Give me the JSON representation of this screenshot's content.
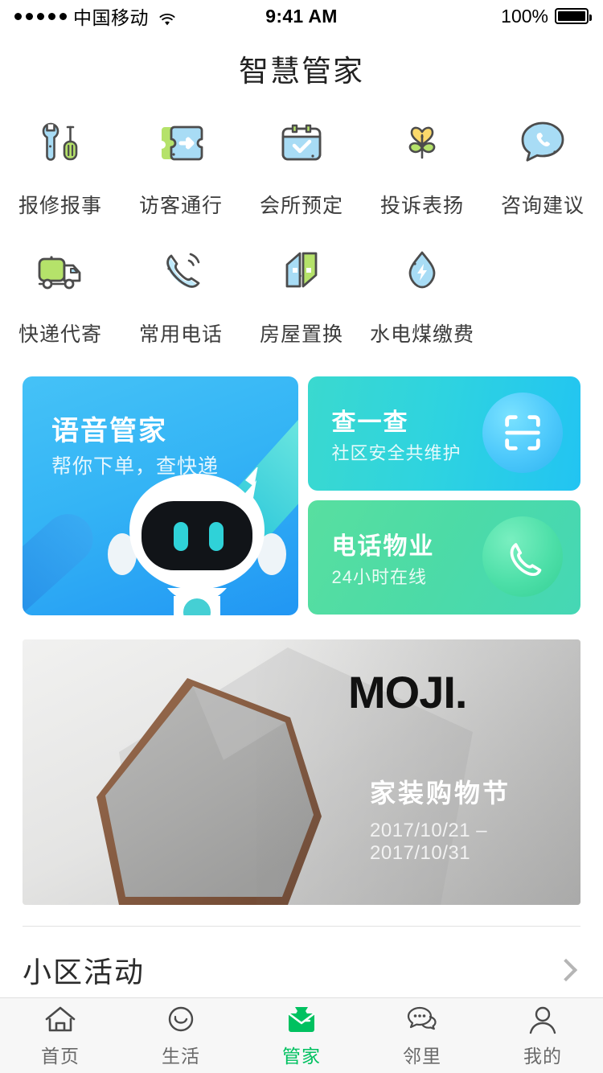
{
  "status_bar": {
    "carrier": "中国移动",
    "signal_icon": "signal-dots-icon",
    "wifi_icon": "wifi-icon",
    "time": "9:41 AM",
    "battery_percent": "100%",
    "battery_icon": "battery-full-icon"
  },
  "header": {
    "title": "智慧管家"
  },
  "services": {
    "row1": [
      {
        "label": "报修报事",
        "icon": "wrench-screwdriver-icon"
      },
      {
        "label": "访客通行",
        "icon": "visitor-pass-ticket-icon"
      },
      {
        "label": "会所预定",
        "icon": "calendar-check-icon"
      },
      {
        "label": "投诉表扬",
        "icon": "heart-flower-icon"
      },
      {
        "label": "咨询建议",
        "icon": "speech-bubble-phone-icon"
      }
    ],
    "row2": [
      {
        "label": "快递代寄",
        "icon": "delivery-truck-icon"
      },
      {
        "label": "常用电话",
        "icon": "ringing-phone-icon"
      },
      {
        "label": "房屋置换",
        "icon": "house-swap-icon"
      },
      {
        "label": "水电煤缴费",
        "icon": "water-drop-bolt-icon"
      }
    ]
  },
  "promos": {
    "voice": {
      "title": "语音管家",
      "subtitle": "帮你下单，查快递",
      "art": "robot-mascot-illustration",
      "bg_from": "#45c2f7",
      "bg_to": "#2196f3"
    },
    "scan": {
      "title": "查一查",
      "subtitle": "社区安全共维护",
      "icon": "scan-frame-icon",
      "bg_from": "#3ad9cf",
      "bg_to": "#22c4f2"
    },
    "call": {
      "title": "电话物业",
      "subtitle": "24小时在线",
      "icon": "phone-handset-icon",
      "bg_from": "#58dfa0",
      "bg_to": "#45d7b5"
    }
  },
  "banner": {
    "brand": "MOJI.",
    "title": "家装购物节",
    "date_range": "2017/10/21 –2017/10/31",
    "art": "hexagon-mirror-photo"
  },
  "section": {
    "title": "小区活动",
    "chevron_icon": "chevron-right-icon"
  },
  "tabbar": {
    "active_color": "#00c160",
    "items": [
      {
        "label": "首页",
        "icon": "home-icon",
        "active": false
      },
      {
        "label": "生活",
        "icon": "smiley-face-icon",
        "active": false
      },
      {
        "label": "管家",
        "icon": "butler-bowtie-icon",
        "active": true
      },
      {
        "label": "邻里",
        "icon": "chat-bubbles-icon",
        "active": false
      },
      {
        "label": "我的",
        "icon": "person-icon",
        "active": false
      }
    ]
  }
}
